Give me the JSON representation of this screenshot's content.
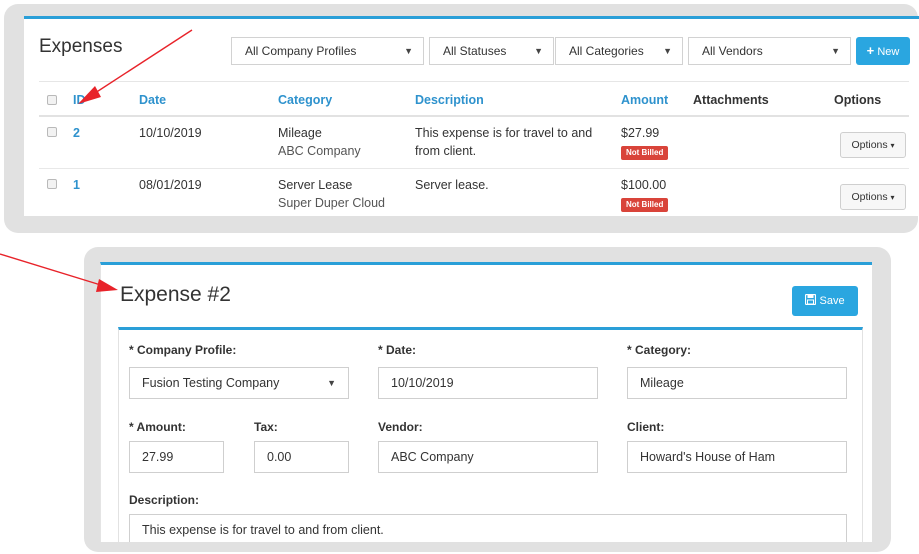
{
  "expenses_list": {
    "title": "Expenses",
    "filters": [
      {
        "label": "All Company Profiles"
      },
      {
        "label": "All Statuses"
      },
      {
        "label": "All Categories"
      },
      {
        "label": "All Vendors"
      }
    ],
    "new_button": {
      "icon": "plus-icon",
      "label": "New"
    },
    "columns": {
      "id": "ID",
      "date": "Date",
      "category": "Category",
      "description": "Description",
      "amount": "Amount",
      "attachments": "Attachments",
      "options": "Options"
    },
    "rows": [
      {
        "id": "2",
        "date": "10/10/2019",
        "category": "Mileage",
        "vendor": "ABC Company",
        "description_line1": "This expense is for travel to and",
        "description_line2": "from client.",
        "amount": "$27.99",
        "status": "Not Billed",
        "options_label": "Options"
      },
      {
        "id": "1",
        "date": "08/01/2019",
        "category": "Server Lease",
        "vendor": "Super Duper Cloud",
        "description_line1": "Server lease.",
        "description_line2": "",
        "amount": "$100.00",
        "status": "Not Billed",
        "options_label": "Options"
      }
    ]
  },
  "expense_detail": {
    "title": "Expense #2",
    "save_button": {
      "icon": "save-icon",
      "label": "Save"
    },
    "fields": {
      "company_profile": {
        "label": "* Company Profile:",
        "value": "Fusion Testing Company"
      },
      "date": {
        "label": "* Date:",
        "value": "10/10/2019"
      },
      "category": {
        "label": "* Category:",
        "value": "Mileage"
      },
      "amount": {
        "label": "* Amount:",
        "value": "27.99"
      },
      "tax": {
        "label": "Tax:",
        "value": "0.00"
      },
      "vendor": {
        "label": "Vendor:",
        "value": "ABC Company"
      },
      "client": {
        "label": "Client:",
        "value": "Howard's House of Ham"
      },
      "description": {
        "label": "Description:",
        "value": "This expense is for travel to and from client."
      }
    }
  },
  "colors": {
    "accent": "#2aa6e0",
    "link": "#2e92cd",
    "badge_red": "#d9443a",
    "annotation_arrow": "#e8232a",
    "frame_gray": "#e1e1e1"
  }
}
